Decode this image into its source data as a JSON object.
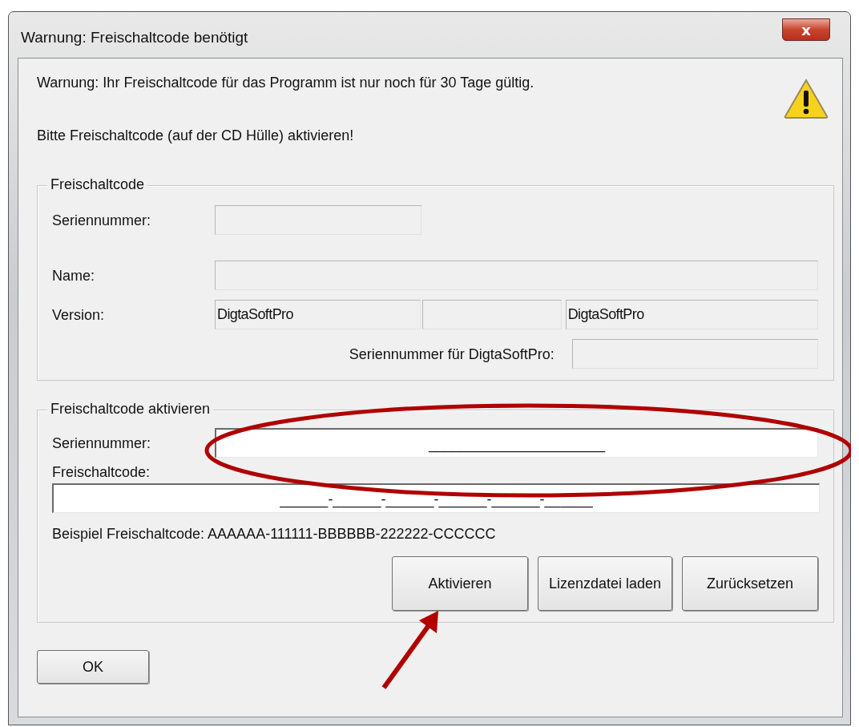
{
  "window": {
    "title": "Warnung: Freischaltcode benötigt",
    "close_symbol": "x"
  },
  "messages": [
    "Warnung: Ihr Freischaltcode für das Programm ist nur noch für 30 Tage gültig.",
    "Bitte Freischaltcode (auf der CD Hülle) aktivieren!"
  ],
  "license_group": {
    "title": "Freischaltcode",
    "serial_label": "Seriennummer:",
    "name_label": "Name:",
    "version_label": "Version:",
    "version_values": [
      "DigtaSoftPro",
      "DigtaSoftPro"
    ],
    "product_serial_label": "Seriennummer für DigtaSoftPro:"
  },
  "activate_group": {
    "title": "Freischaltcode aktivieren",
    "serial_label": "Seriennummer:",
    "serial_mask": "______________________",
    "code_label": "Freischaltcode:",
    "code_mask": "______-______-______-______-______-______",
    "example": "Beispiel Freischaltcode: AAAAAA-111111-BBBBBB-222222-CCCCCC",
    "buttons": [
      "Aktivieren",
      "Lizenzdatei laden",
      "Zurücksetzen"
    ]
  },
  "ok_button": "OK",
  "annotations": [
    {
      "kind": "ellipse"
    },
    {
      "kind": "arrow"
    }
  ]
}
